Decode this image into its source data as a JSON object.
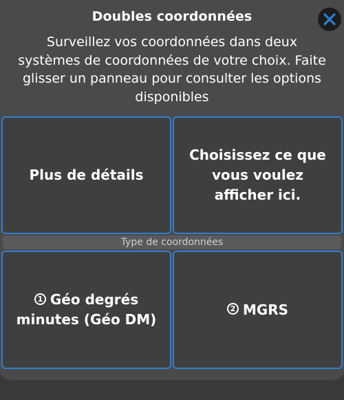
{
  "sheet": {
    "title": "Doubles coordonnées",
    "instructions": "Surveillez vos coordonnées dans deux systèmes de coordonnées de votre choix. Faite glisser un panneau pour consulter les options disponibles"
  },
  "top_panels": {
    "left_label": "Plus de détails",
    "right_label": "Choisissez ce que vous voulez afficher ici."
  },
  "section": {
    "label": "Type de coordonnées"
  },
  "coordinate_panels": {
    "first": {
      "number": "1",
      "label": "Géo degrés minutes (Géo DM)"
    },
    "second": {
      "number": "2",
      "label": "MGRS"
    }
  },
  "colors": {
    "accent": "#2f7fd0",
    "sheet_background": "#4a4a4a",
    "panel_background": "#3f3f3f"
  },
  "icons": {
    "close": "close-icon"
  }
}
